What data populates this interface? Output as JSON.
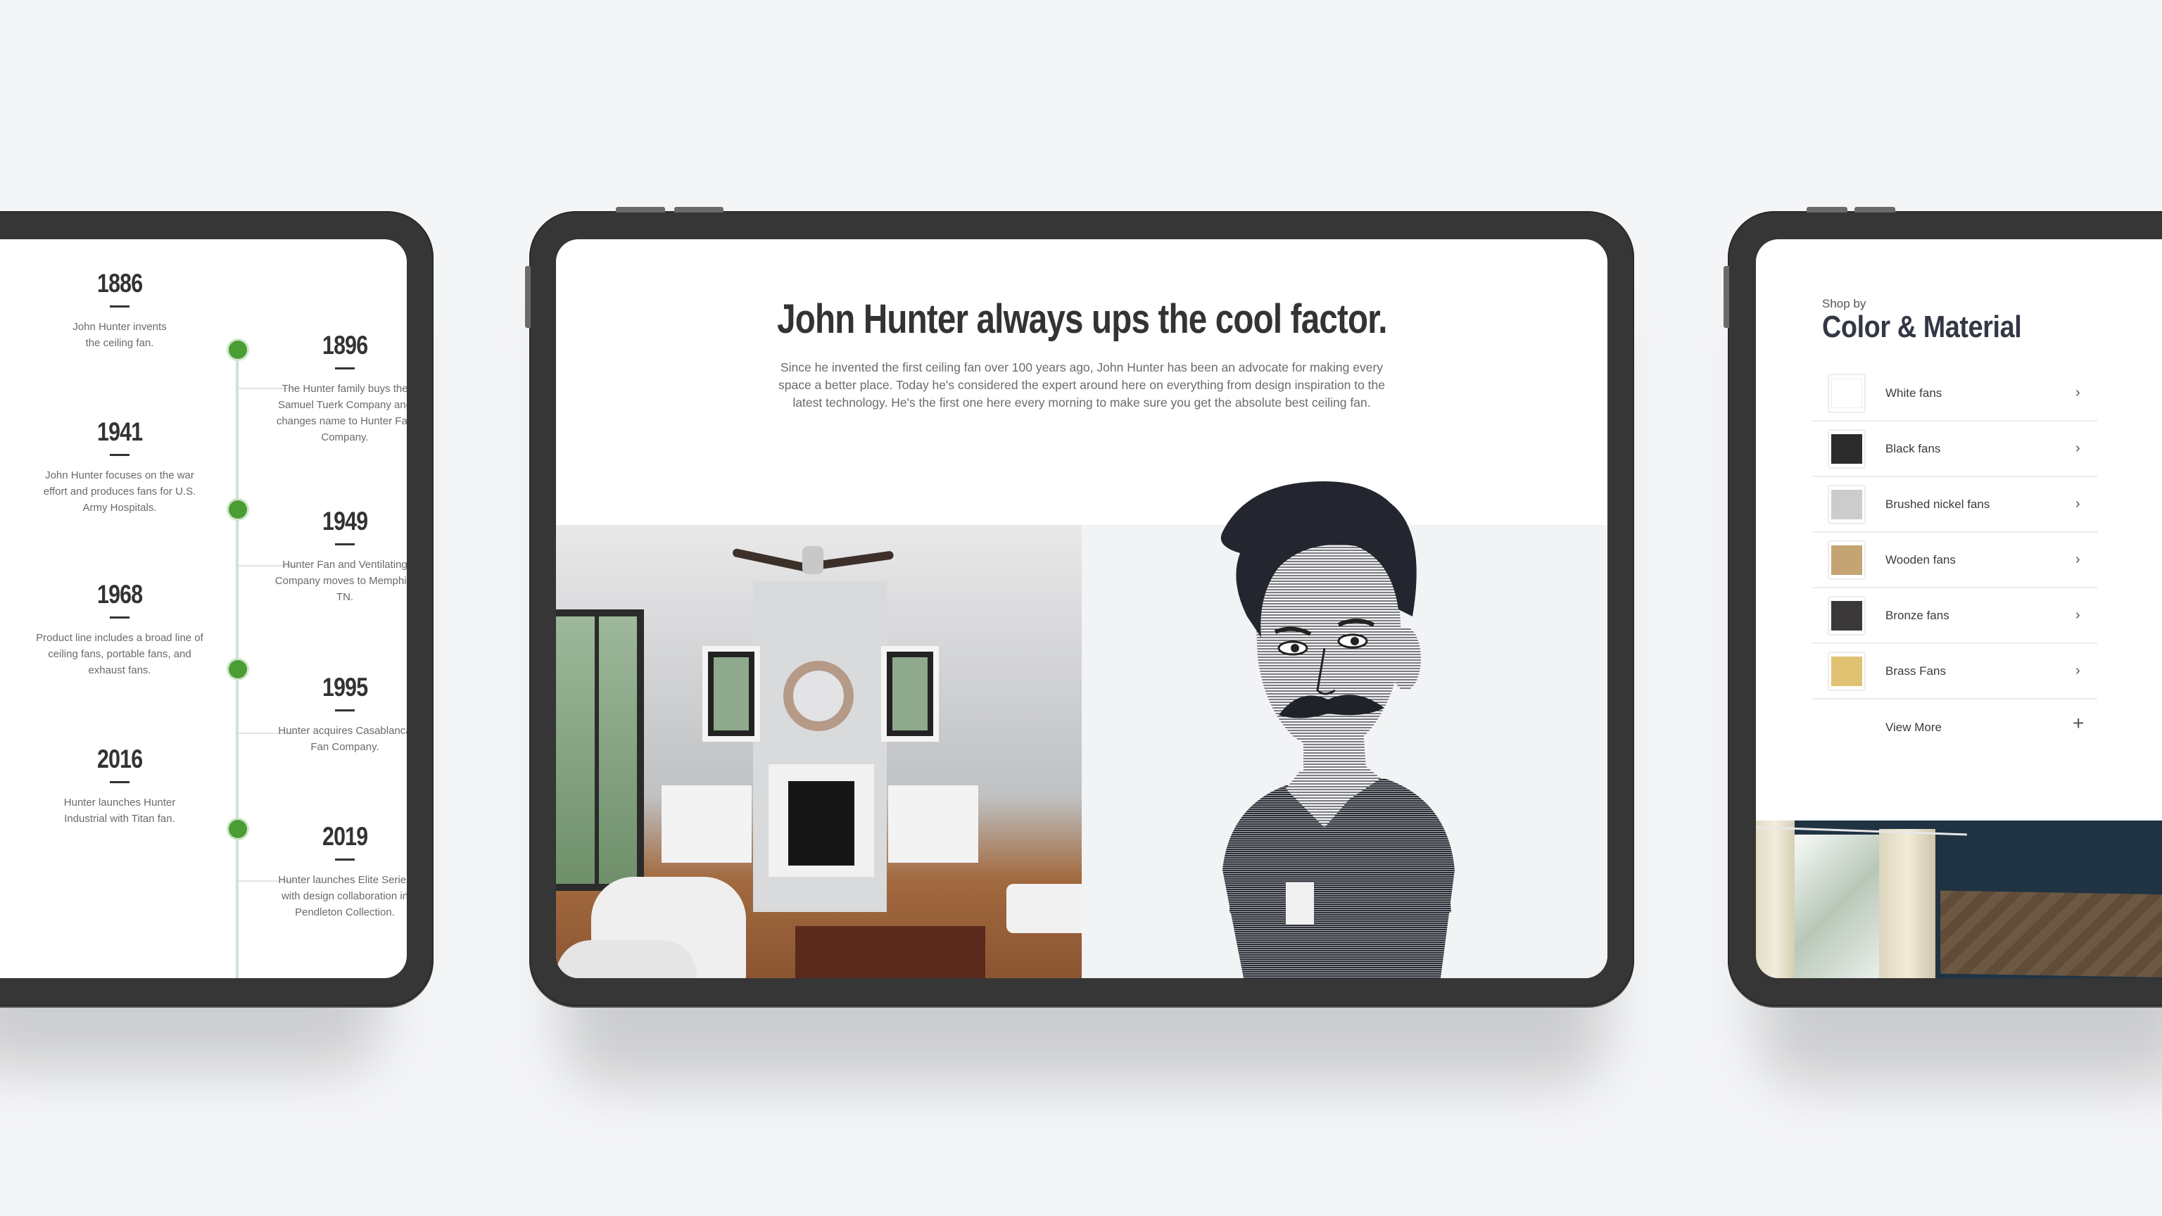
{
  "timeline": {
    "left_items": [
      {
        "year": "1886",
        "text": "John Hunter invents the ceiling fan."
      },
      {
        "year": "1941",
        "text": "John Hunter focuses on the war effort and produces fans for U.S. Army Hospitals."
      },
      {
        "year": "1968",
        "text": "Product line includes a broad line of ceiling fans, portable fans, and exhaust fans."
      },
      {
        "year": "2016",
        "text": "Hunter launches Hunter Industrial with Titan fan."
      }
    ],
    "right_items": [
      {
        "year": "1896",
        "text": "The Hunter family buys the Samuel Tuerk Company and changes name to Hunter Fan Company."
      },
      {
        "year": "1949",
        "text": "Hunter Fan and Ventilating Company moves to Memphis, TN."
      },
      {
        "year": "1995",
        "text": "Hunter acquires Casablanca Fan Company."
      },
      {
        "year": "2019",
        "text": "Hunter launches Elite Series with design collaboration in Pendleton Collection."
      }
    ],
    "accent_color": "#4a9d32"
  },
  "hero": {
    "title": "John Hunter always ups the cool factor.",
    "paragraph": "Since he invented the first ceiling fan over 100 years ago, John Hunter has been an advocate for making every space a better place. Today he's considered the expert around here on everything from design inspiration to the latest technology. He's the first one here every morning to make sure you get the absolute best ceiling fan.",
    "images": [
      {
        "name": "living-room-with-ceiling-fan-photo"
      },
      {
        "name": "john-hunter-engraving-illustration"
      }
    ]
  },
  "shop": {
    "kicker": "Shop by",
    "title": "Color & Material",
    "items": [
      {
        "label": "White fans",
        "swatch": "#ffffff"
      },
      {
        "label": "Black fans",
        "swatch": "#2c2c2c"
      },
      {
        "label": "Brushed nickel fans",
        "swatch": "#cccccc"
      },
      {
        "label": "Wooden fans",
        "swatch": "#c5a473"
      },
      {
        "label": "Bronze fans",
        "swatch": "#3a3839"
      },
      {
        "label": "Brass Fans",
        "swatch": "#e0c272"
      }
    ],
    "view_more": "View More",
    "chevron": "›",
    "plus": "+"
  }
}
